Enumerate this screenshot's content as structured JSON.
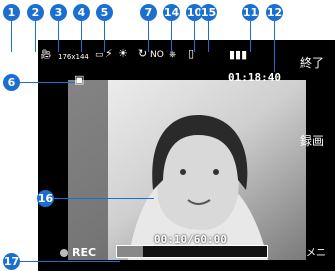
{
  "markers": [
    "1",
    "2",
    "3",
    "4",
    "5",
    "6",
    "7",
    "8",
    "9",
    "10",
    "11",
    "12",
    "14",
    "15",
    "16",
    "17"
  ],
  "status": {
    "size_label": "176x144",
    "no_label": "NO",
    "clock": "01:18:40"
  },
  "softkeys": {
    "end": "終了",
    "screen": "録画",
    "menu": "メニ"
  },
  "recording": {
    "label": "REC",
    "timer": "00:10/60:00",
    "progress_fraction": 0.17
  }
}
